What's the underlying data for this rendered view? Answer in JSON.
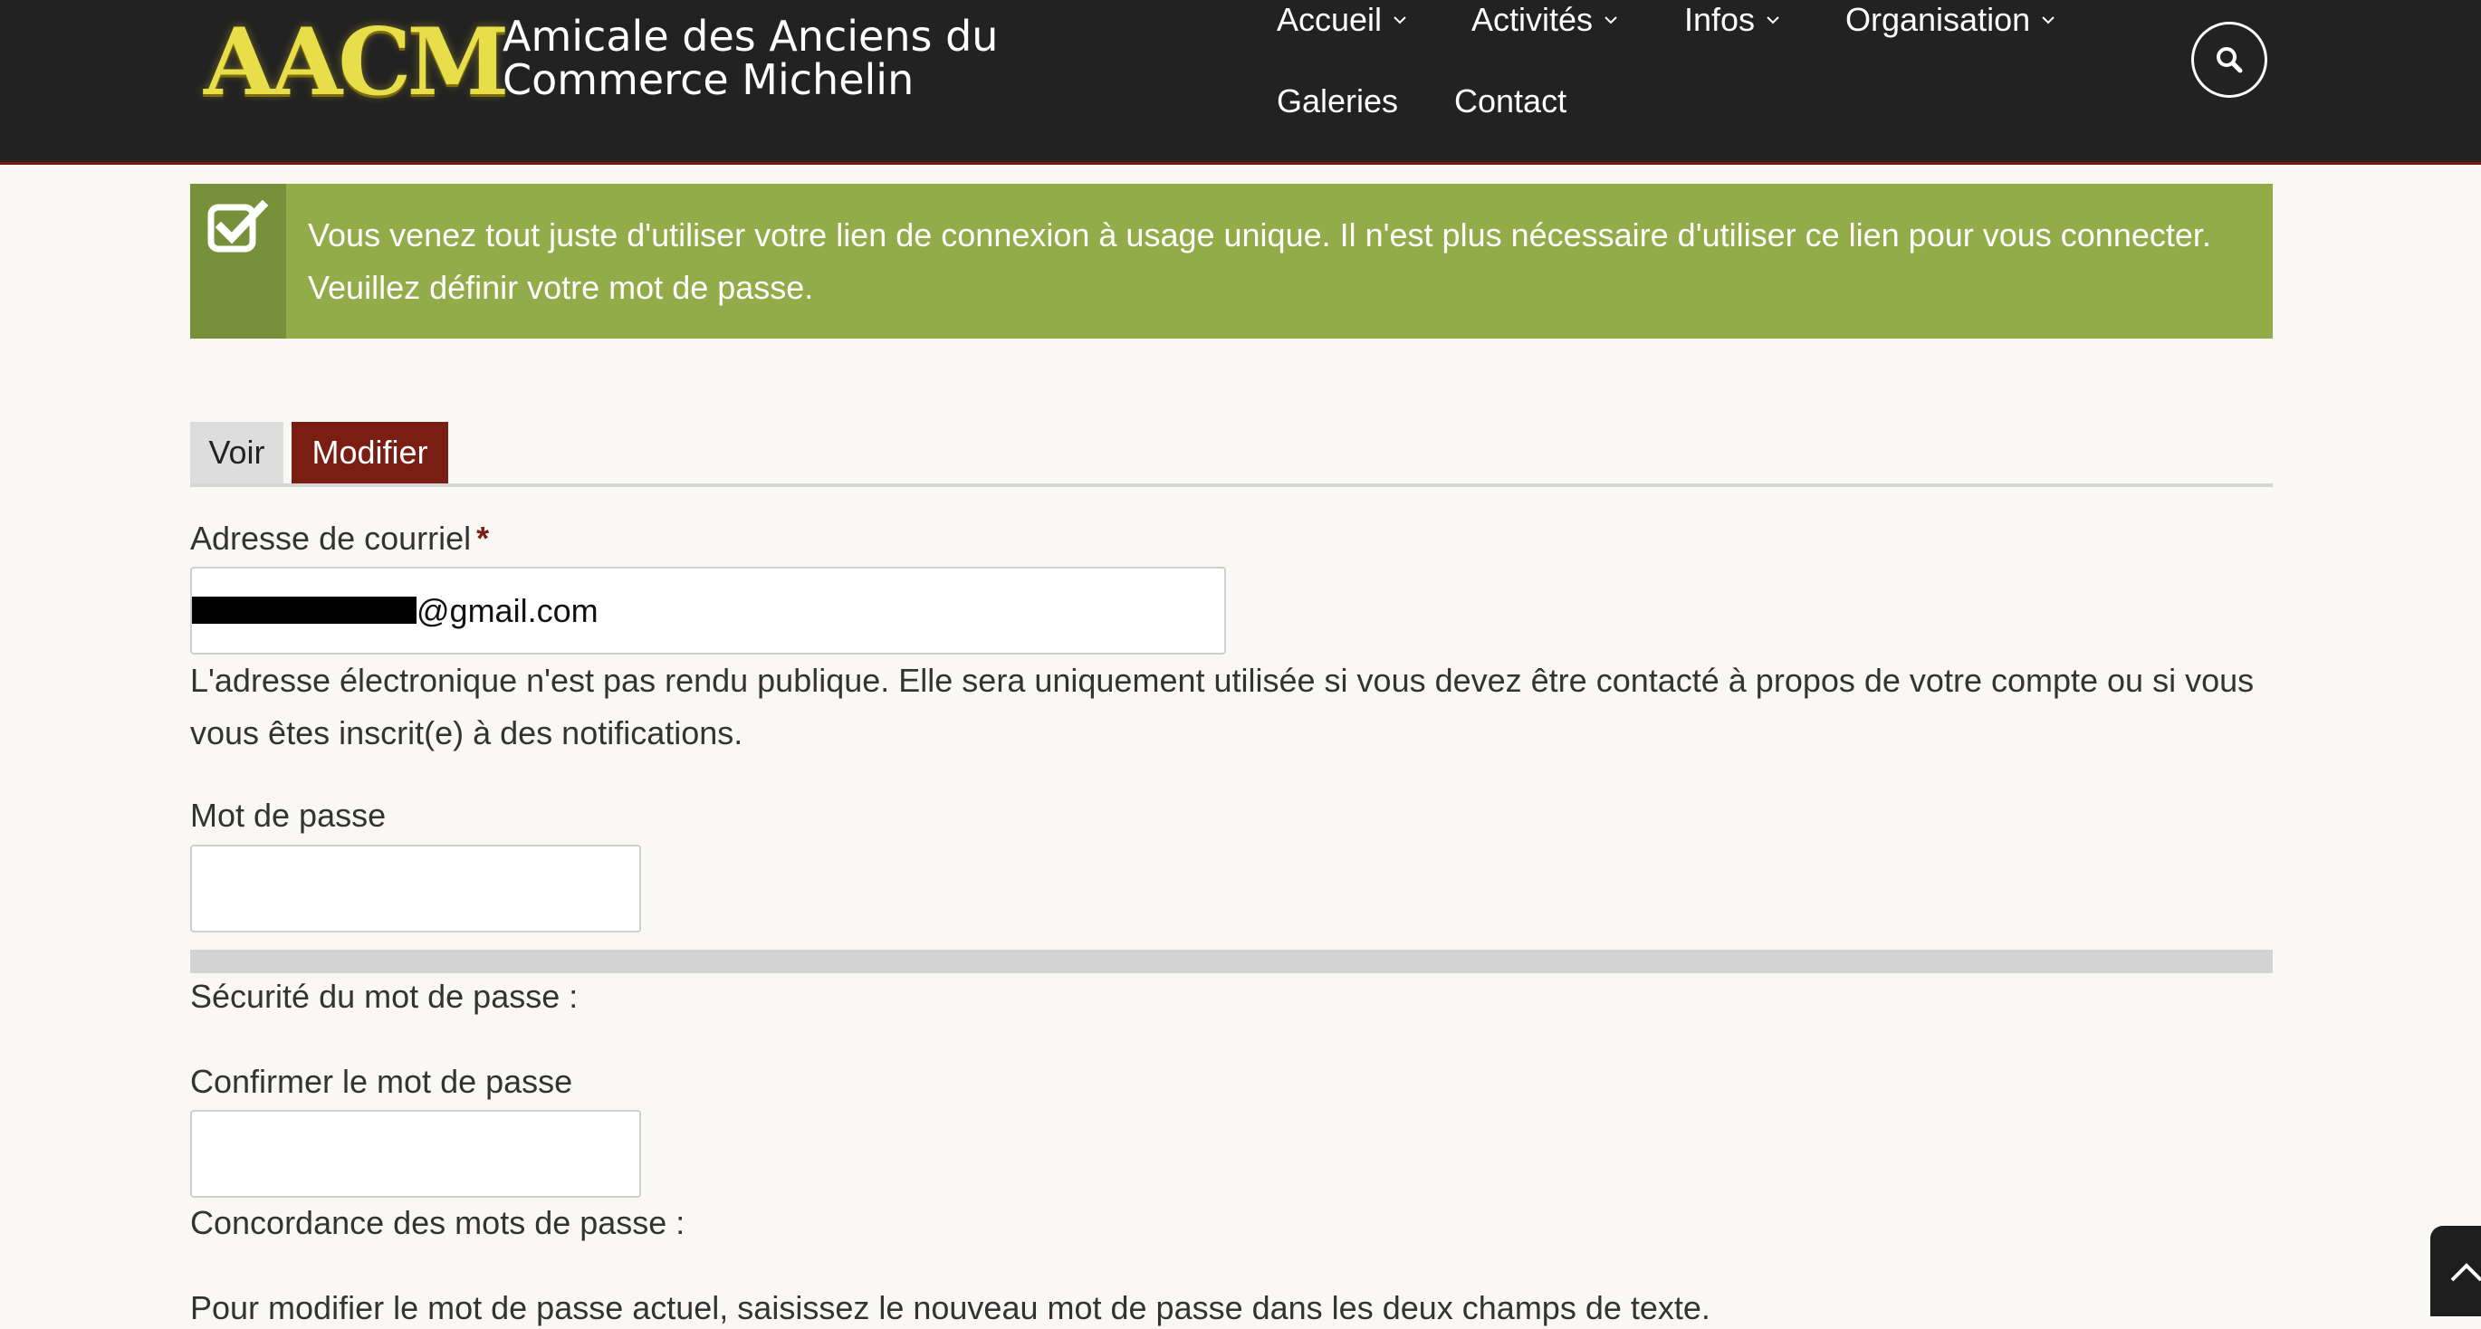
{
  "header": {
    "logo_text": "AACM",
    "site_name_line1": "Amicale des Anciens du",
    "site_name_line2": "Commerce Michelin",
    "nav": [
      {
        "label": "Accueil",
        "has_dropdown": true
      },
      {
        "label": "Activités",
        "has_dropdown": true
      },
      {
        "label": "Infos",
        "has_dropdown": true
      },
      {
        "label": "Organisation",
        "has_dropdown": true
      },
      {
        "label": "Galeries",
        "has_dropdown": false
      },
      {
        "label": "Contact",
        "has_dropdown": false
      }
    ],
    "search_icon": "search-icon"
  },
  "status": {
    "icon": "checkbox-checked-icon",
    "line1": "Vous venez tout juste d'utiliser votre lien de connexion à usage unique. Il n'est plus nécessaire d'utiliser ce lien pour vous connecter.",
    "line2": "Veuillez définir votre mot de passe."
  },
  "tabs": [
    {
      "label": "Voir",
      "active": false
    },
    {
      "label": "Modifier",
      "active": true
    }
  ],
  "form": {
    "email": {
      "label": "Adresse de courriel",
      "required_marker": "*",
      "value_visible": "@gmail.com",
      "help_line1": "L'adresse électronique n'est pas rendu publique. Elle sera uniquement utilisée si vous devez être contacté à propos de votre compte ou si vous",
      "help_line2": "vous êtes inscrit(e) à des notifications."
    },
    "password": {
      "label": "Mot de passe",
      "value": "",
      "strength_label": "Sécurité du mot de passe :",
      "strength_level": 0
    },
    "confirm": {
      "label": "Confirmer le mot de passe",
      "value": "",
      "match_label": "Concordance des mots de passe :"
    },
    "instructions": "Pour modifier le mot de passe actuel, saisissez le nouveau mot de passe dans les deux champs de texte."
  },
  "back_to_top_icon": "chevron-up-icon",
  "colors": {
    "header_bg": "#222222",
    "accent_red": "#7a1d12",
    "status_green": "#93ac4a",
    "status_green_dark": "#76913a",
    "page_bg": "#faf8f4",
    "logo_gold": "#e8de4a"
  }
}
